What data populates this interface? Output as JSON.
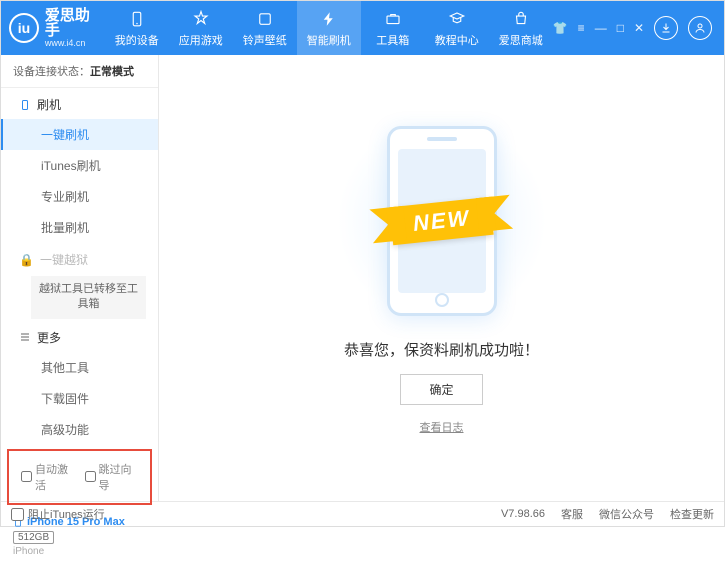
{
  "app": {
    "name": "爱思助手",
    "url": "www.i4.cn"
  },
  "nav": [
    {
      "label": "我的设备"
    },
    {
      "label": "应用游戏"
    },
    {
      "label": "铃声壁纸"
    },
    {
      "label": "智能刷机"
    },
    {
      "label": "工具箱"
    },
    {
      "label": "教程中心"
    },
    {
      "label": "爱思商城"
    }
  ],
  "status": {
    "label": "设备连接状态：",
    "value": "正常模式"
  },
  "sidebar": {
    "flash": {
      "header": "刷机",
      "items": [
        "一键刷机",
        "iTunes刷机",
        "专业刷机",
        "批量刷机"
      ]
    },
    "jailbreak": {
      "header": "一键越狱",
      "note": "越狱工具已转移至工具箱"
    },
    "more": {
      "header": "更多",
      "items": [
        "其他工具",
        "下载固件",
        "高级功能"
      ]
    }
  },
  "checkboxes": {
    "auto_activate": "自动激活",
    "skip_guide": "跳过向导"
  },
  "device": {
    "name": "iPhone 15 Pro Max",
    "storage": "512GB",
    "type": "iPhone"
  },
  "main": {
    "ribbon": "NEW",
    "success": "恭喜您，保资料刷机成功啦！",
    "confirm": "确定",
    "view_log": "查看日志"
  },
  "footer": {
    "block_itunes": "阻止iTunes运行",
    "version": "V7.98.66",
    "service": "客服",
    "wechat": "微信公众号",
    "check_update": "检查更新"
  }
}
